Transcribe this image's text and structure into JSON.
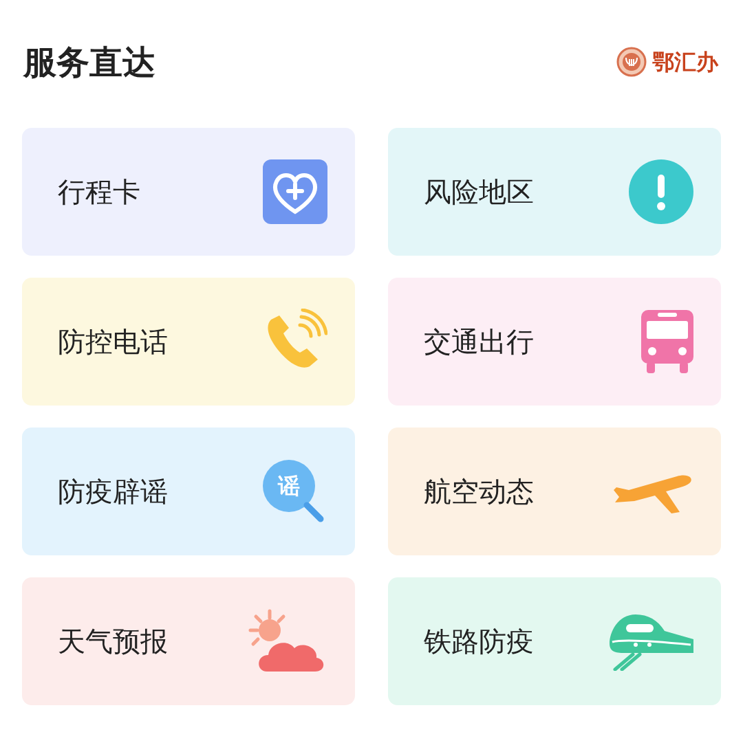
{
  "header": {
    "title": "服务直达",
    "logo_text": "鄂汇办"
  },
  "services": [
    {
      "label": "行程卡",
      "kind": "heart",
      "color": "#eef0fd"
    },
    {
      "label": "风险地区",
      "kind": "alert",
      "color": "#e3f6f8"
    },
    {
      "label": "防控电话",
      "kind": "phone",
      "color": "#fdf8df"
    },
    {
      "label": "交通出行",
      "kind": "bus",
      "color": "#fdeef5"
    },
    {
      "label": "防疫辟谣",
      "kind": "rumor",
      "color": "#e3f3fd",
      "icon_text": "谣"
    },
    {
      "label": "航空动态",
      "kind": "plane",
      "color": "#fdf1e3"
    },
    {
      "label": "天气预报",
      "kind": "weather",
      "color": "#fdeceb"
    },
    {
      "label": "铁路防疫",
      "kind": "train",
      "color": "#e3f8f0"
    }
  ]
}
